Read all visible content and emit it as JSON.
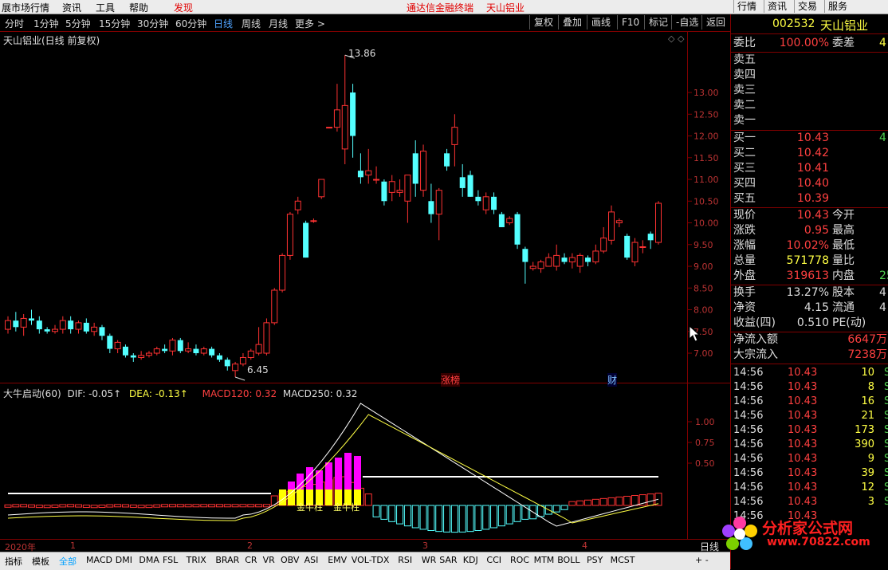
{
  "menu": {
    "items": [
      "展市场行情",
      "资讯",
      "工具",
      "帮助"
    ],
    "discover": "发现",
    "center_title": "通达信金融终端",
    "center_stock": "天山铝业",
    "right_buttons": [
      "行情",
      "资讯",
      "交易",
      "服务"
    ]
  },
  "toolbar": {
    "periods": [
      "分时",
      "1分钟",
      "5分钟",
      "15分钟",
      "30分钟",
      "60分钟",
      "日线",
      "周线",
      "月线",
      "更多 >"
    ],
    "active_period": "日线",
    "buttons": [
      "复权",
      "叠加",
      "画线",
      "F10",
      "标记",
      "-自选",
      "返回"
    ]
  },
  "chart": {
    "title": "天山铝业(日线 前复权)",
    "high_label": "13.86",
    "low_label": "6.45",
    "marker_zhangting": "涨榜",
    "marker_cai": "财",
    "price_axis": [
      "13.00",
      "12.50",
      "12.00",
      "11.50",
      "11.00",
      "10.50",
      "10.00",
      "9.50",
      "9.00",
      "8.50",
      "8.00",
      "7.50",
      "7.00"
    ],
    "indicator_title": "大牛启动(60)",
    "dif": "DIF: -0.05↑",
    "dea": "DEA: -0.13↑",
    "macd120": "MACD120: 0.32",
    "macd250": "MACD250: 0.32",
    "indicator_axis": [
      "1.00",
      "0.75",
      "0.50"
    ],
    "zhu1": "金牛柱",
    "zhu2": "金牛柱",
    "date_year": "2020年",
    "date_months": [
      "1",
      "2",
      "3",
      "4"
    ],
    "axis_mode": "日线"
  },
  "chart_data": {
    "type": "candlestick",
    "title": "天山铝业(日线 前复权)",
    "ylim": [
      6.3,
      14.0
    ],
    "candles": [
      {
        "o": 7.55,
        "c": 7.75,
        "h": 7.85,
        "l": 7.45
      },
      {
        "o": 7.75,
        "c": 7.6,
        "h": 7.95,
        "l": 7.5
      },
      {
        "o": 7.6,
        "c": 7.8,
        "h": 7.9,
        "l": 7.4
      },
      {
        "o": 7.8,
        "c": 7.75,
        "h": 8.0,
        "l": 7.65
      },
      {
        "o": 7.75,
        "c": 7.55,
        "h": 7.85,
        "l": 7.45
      },
      {
        "o": 7.55,
        "c": 7.5,
        "h": 7.6,
        "l": 7.45
      },
      {
        "o": 7.5,
        "c": 7.55,
        "h": 7.65,
        "l": 7.45
      },
      {
        "o": 7.55,
        "c": 7.75,
        "h": 7.85,
        "l": 7.45
      },
      {
        "o": 7.75,
        "c": 7.55,
        "h": 7.85,
        "l": 7.45
      },
      {
        "o": 7.55,
        "c": 7.7,
        "h": 7.75,
        "l": 7.45
      },
      {
        "o": 7.7,
        "c": 7.5,
        "h": 7.8,
        "l": 7.45
      },
      {
        "o": 7.5,
        "c": 7.6,
        "h": 7.7,
        "l": 7.4
      },
      {
        "o": 7.6,
        "c": 7.4,
        "h": 7.65,
        "l": 7.3
      },
      {
        "o": 7.4,
        "c": 7.1,
        "h": 7.45,
        "l": 7.0
      },
      {
        "o": 7.1,
        "c": 7.25,
        "h": 7.3,
        "l": 7.0
      },
      {
        "o": 7.15,
        "c": 6.95,
        "h": 7.2,
        "l": 6.9
      },
      {
        "o": 6.95,
        "c": 6.9,
        "h": 7.0,
        "l": 6.8
      },
      {
        "o": 6.9,
        "c": 6.95,
        "h": 7.05,
        "l": 6.85
      },
      {
        "o": 6.95,
        "c": 7.0,
        "h": 7.05,
        "l": 6.9
      },
      {
        "o": 7.0,
        "c": 7.1,
        "h": 7.15,
        "l": 6.95
      },
      {
        "o": 7.1,
        "c": 7.05,
        "h": 7.2,
        "l": 7.0
      },
      {
        "o": 7.05,
        "c": 7.3,
        "h": 7.35,
        "l": 6.95
      },
      {
        "o": 7.3,
        "c": 7.05,
        "h": 7.35,
        "l": 7.0
      },
      {
        "o": 7.05,
        "c": 7.1,
        "h": 7.25,
        "l": 7.0
      },
      {
        "o": 7.1,
        "c": 7.0,
        "h": 7.2,
        "l": 6.95
      },
      {
        "o": 7.0,
        "c": 7.1,
        "h": 7.15,
        "l": 6.95
      },
      {
        "o": 7.1,
        "c": 6.95,
        "h": 7.15,
        "l": 6.9
      },
      {
        "o": 6.95,
        "c": 6.85,
        "h": 7.0,
        "l": 6.8
      },
      {
        "o": 6.85,
        "c": 6.7,
        "h": 6.9,
        "l": 6.6
      },
      {
        "o": 6.6,
        "c": 6.75,
        "h": 6.8,
        "l": 6.45
      },
      {
        "o": 6.75,
        "c": 6.9,
        "h": 7.0,
        "l": 6.7
      },
      {
        "o": 6.9,
        "c": 7.05,
        "h": 7.1,
        "l": 6.85
      },
      {
        "o": 7.0,
        "c": 7.2,
        "h": 7.6,
        "l": 6.95
      },
      {
        "o": 7.0,
        "c": 7.7,
        "h": 7.8,
        "l": 6.95
      },
      {
        "o": 7.7,
        "c": 8.45,
        "h": 8.5,
        "l": 7.65
      },
      {
        "o": 8.45,
        "c": 9.25,
        "h": 9.3,
        "l": 8.4
      },
      {
        "o": 9.25,
        "c": 10.2,
        "h": 10.25,
        "l": 9.15
      },
      {
        "o": 10.3,
        "c": 10.5,
        "h": 10.6,
        "l": 10.2
      },
      {
        "o": 10.0,
        "c": 9.2,
        "h": 10.05,
        "l": 9.2
      },
      {
        "o": 10.05,
        "c": 10.05,
        "h": 10.1,
        "l": 10.0
      },
      {
        "o": 10.6,
        "c": 11.0,
        "h": 11.0,
        "l": 10.55
      },
      {
        "o": 12.2,
        "c": 12.2,
        "h": 12.2,
        "l": 12.2
      },
      {
        "o": 12.2,
        "c": 12.6,
        "h": 13.2,
        "l": 12.1
      },
      {
        "o": 11.7,
        "c": 12.7,
        "h": 13.86,
        "l": 11.35
      },
      {
        "o": 13.0,
        "c": 12.0,
        "h": 13.2,
        "l": 11.5
      },
      {
        "o": 11.2,
        "c": 11.05,
        "h": 11.6,
        "l": 10.9
      },
      {
        "o": 11.1,
        "c": 11.2,
        "h": 11.7,
        "l": 10.9
      },
      {
        "o": 11.0,
        "c": 11.0,
        "h": 11.3,
        "l": 10.9
      },
      {
        "o": 10.95,
        "c": 10.5,
        "h": 11.0,
        "l": 10.4
      },
      {
        "o": 10.7,
        "c": 10.95,
        "h": 11.1,
        "l": 10.5
      },
      {
        "o": 10.7,
        "c": 10.75,
        "h": 11.0,
        "l": 10.6
      },
      {
        "o": 10.5,
        "c": 11.1,
        "h": 11.1,
        "l": 10.0
      },
      {
        "o": 11.6,
        "c": 10.9,
        "h": 11.9,
        "l": 10.6
      },
      {
        "o": 10.75,
        "c": 11.65,
        "h": 11.8,
        "l": 10.6
      },
      {
        "o": 10.5,
        "c": 10.2,
        "h": 10.9,
        "l": 10.0
      },
      {
        "o": 10.2,
        "c": 10.75,
        "h": 10.8,
        "l": 9.6
      },
      {
        "o": 11.6,
        "c": 11.3,
        "h": 11.7,
        "l": 11.2
      },
      {
        "o": 11.8,
        "c": 12.2,
        "h": 12.5,
        "l": 11.3
      },
      {
        "o": 11.05,
        "c": 10.8,
        "h": 11.35,
        "l": 10.6
      },
      {
        "o": 11.1,
        "c": 10.6,
        "h": 11.2,
        "l": 10.6
      },
      {
        "o": 10.6,
        "c": 10.5,
        "h": 10.75,
        "l": 10.4
      },
      {
        "o": 10.3,
        "c": 10.6,
        "h": 10.7,
        "l": 10.2
      },
      {
        "o": 10.6,
        "c": 10.3,
        "h": 10.7,
        "l": 10.2
      },
      {
        "o": 10.2,
        "c": 9.9,
        "h": 10.25,
        "l": 9.9
      },
      {
        "o": 10.0,
        "c": 10.1,
        "h": 10.15,
        "l": 9.95
      },
      {
        "o": 10.2,
        "c": 9.5,
        "h": 10.25,
        "l": 9.4
      },
      {
        "o": 9.4,
        "c": 9.1,
        "h": 9.45,
        "l": 8.6
      },
      {
        "o": 8.95,
        "c": 9.0,
        "h": 9.1,
        "l": 8.9
      },
      {
        "o": 8.95,
        "c": 9.1,
        "h": 9.15,
        "l": 8.85
      },
      {
        "o": 9.0,
        "c": 9.2,
        "h": 9.3,
        "l": 9.0
      },
      {
        "o": 9.0,
        "c": 9.25,
        "h": 9.5,
        "l": 8.9
      },
      {
        "o": 9.2,
        "c": 9.1,
        "h": 9.3,
        "l": 9.05
      },
      {
        "o": 9.1,
        "c": 9.2,
        "h": 9.3,
        "l": 8.95
      },
      {
        "o": 9.0,
        "c": 9.25,
        "h": 9.3,
        "l": 8.85
      },
      {
        "o": 9.2,
        "c": 9.1,
        "h": 9.25,
        "l": 9.0
      },
      {
        "o": 9.1,
        "c": 9.35,
        "h": 9.5,
        "l": 9.05
      },
      {
        "o": 9.35,
        "c": 9.65,
        "h": 9.9,
        "l": 9.3
      },
      {
        "o": 9.6,
        "c": 10.25,
        "h": 10.4,
        "l": 9.5
      },
      {
        "o": 10.0,
        "c": 10.05,
        "h": 10.1,
        "l": 9.9
      },
      {
        "o": 9.7,
        "c": 9.2,
        "h": 9.75,
        "l": 9.15
      },
      {
        "o": 9.1,
        "c": 9.55,
        "h": 9.65,
        "l": 9.0
      },
      {
        "o": 9.45,
        "c": 9.45,
        "h": 9.6,
        "l": 9.3
      },
      {
        "o": 9.75,
        "c": 9.6,
        "h": 9.8,
        "l": 9.4
      },
      {
        "o": 9.55,
        "c": 10.45,
        "h": 10.5,
        "l": 9.5
      }
    ]
  },
  "quote": {
    "code": "002532",
    "name": "天山铝业",
    "weibi_label": "委比",
    "weibi_value": "100.00%",
    "weicha_label": "委差",
    "weicha_value": "4",
    "sell": [
      "卖五",
      "卖四",
      "卖三",
      "卖二",
      "卖一"
    ],
    "buy": [
      {
        "label": "买一",
        "price": "10.43",
        "vol": "4"
      },
      {
        "label": "买二",
        "price": "10.42",
        "vol": ""
      },
      {
        "label": "买三",
        "price": "10.41",
        "vol": ""
      },
      {
        "label": "买四",
        "price": "10.40",
        "vol": ""
      },
      {
        "label": "买五",
        "price": "10.39",
        "vol": ""
      }
    ],
    "stats": [
      {
        "l": "现价",
        "v": "10.43",
        "l2": "今开",
        "v2": ""
      },
      {
        "l": "涨跌",
        "v": "0.95",
        "l2": "最高",
        "v2": ""
      },
      {
        "l": "涨幅",
        "v": "10.02%",
        "l2": "最低",
        "v2": ""
      },
      {
        "l": "总量",
        "v": "571778",
        "l2": "量比",
        "v2": ""
      },
      {
        "l": "外盘",
        "v": "319613",
        "l2": "内盘",
        "v2": "25"
      }
    ],
    "stats2": [
      {
        "l": "换手",
        "v": "13.27%",
        "l2": "股本",
        "v2": "4"
      },
      {
        "l": "净资",
        "v": "4.15",
        "l2": "流通",
        "v2": "4"
      },
      {
        "l": "收益(四)",
        "v": "0.510",
        "l2": "PE(动)",
        "v2": ""
      }
    ],
    "flow": [
      {
        "l": "净流入额",
        "v": "6647万"
      },
      {
        "l": "大宗流入",
        "v": "7238万"
      }
    ],
    "ticks": [
      {
        "t": "14:56",
        "p": "10.43",
        "v": "10",
        "s": "S"
      },
      {
        "t": "14:56",
        "p": "10.43",
        "v": "8",
        "s": "S"
      },
      {
        "t": "14:56",
        "p": "10.43",
        "v": "16",
        "s": "S"
      },
      {
        "t": "14:56",
        "p": "10.43",
        "v": "21",
        "s": "S"
      },
      {
        "t": "14:56",
        "p": "10.43",
        "v": "173",
        "s": "S"
      },
      {
        "t": "14:56",
        "p": "10.43",
        "v": "390",
        "s": "S"
      },
      {
        "t": "14:56",
        "p": "10.43",
        "v": "9",
        "s": "S"
      },
      {
        "t": "14:56",
        "p": "10.43",
        "v": "39",
        "s": "S"
      },
      {
        "t": "14:56",
        "p": "10.43",
        "v": "12",
        "s": "S"
      },
      {
        "t": "14:56",
        "p": "10.43",
        "v": "3",
        "s": "S"
      },
      {
        "t": "14:56",
        "p": "10.43",
        "v": "",
        "s": ""
      }
    ]
  },
  "bottom_tabs": [
    "指标",
    "模板",
    "全部",
    "MACD",
    "DMI",
    "DMA",
    "FSL",
    "TRIX",
    "BRAR",
    "CR",
    "VR",
    "OBV",
    "ASI",
    "EMV",
    "VOL-TDX",
    "RSI",
    "WR",
    "SAR",
    "KDJ",
    "CCI",
    "ROC",
    "MTM",
    "BOLL",
    "PSY",
    "MCST"
  ],
  "bottom_active": "全部",
  "watermark": {
    "text": "分析家公式网",
    "url": "www.70822.com"
  },
  "colors": {
    "up": "#ff3232",
    "down": "#54ffff",
    "bg": "#000000",
    "axis": "#800000",
    "magenta": "#ff00ff",
    "yellow": "#ffff00"
  }
}
